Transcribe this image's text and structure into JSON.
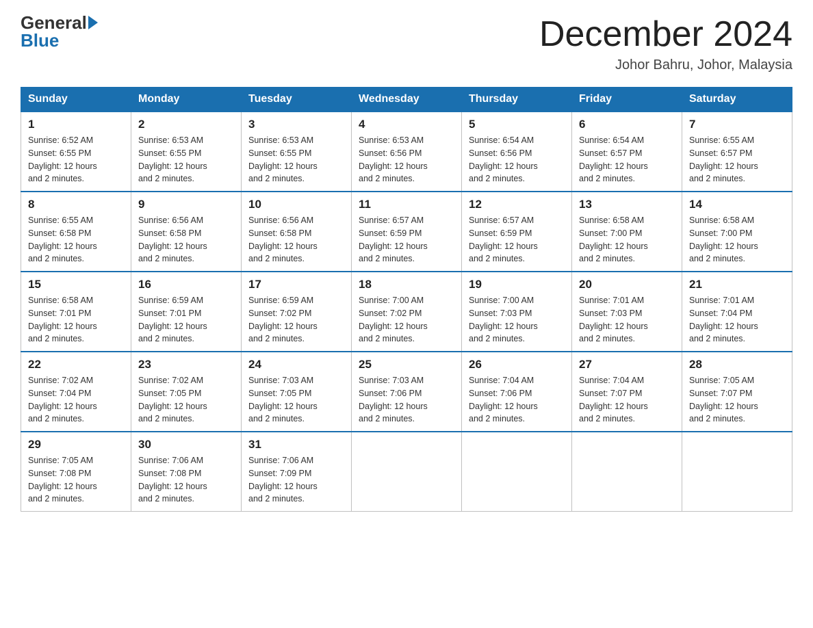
{
  "header": {
    "logo_general": "General",
    "logo_blue": "Blue",
    "title": "December 2024",
    "subtitle": "Johor Bahru, Johor, Malaysia"
  },
  "days_of_week": [
    "Sunday",
    "Monday",
    "Tuesday",
    "Wednesday",
    "Thursday",
    "Friday",
    "Saturday"
  ],
  "weeks": [
    [
      {
        "day": "1",
        "sunrise": "6:52 AM",
        "sunset": "6:55 PM",
        "daylight": "12 hours and 2 minutes."
      },
      {
        "day": "2",
        "sunrise": "6:53 AM",
        "sunset": "6:55 PM",
        "daylight": "12 hours and 2 minutes."
      },
      {
        "day": "3",
        "sunrise": "6:53 AM",
        "sunset": "6:55 PM",
        "daylight": "12 hours and 2 minutes."
      },
      {
        "day": "4",
        "sunrise": "6:53 AM",
        "sunset": "6:56 PM",
        "daylight": "12 hours and 2 minutes."
      },
      {
        "day": "5",
        "sunrise": "6:54 AM",
        "sunset": "6:56 PM",
        "daylight": "12 hours and 2 minutes."
      },
      {
        "day": "6",
        "sunrise": "6:54 AM",
        "sunset": "6:57 PM",
        "daylight": "12 hours and 2 minutes."
      },
      {
        "day": "7",
        "sunrise": "6:55 AM",
        "sunset": "6:57 PM",
        "daylight": "12 hours and 2 minutes."
      }
    ],
    [
      {
        "day": "8",
        "sunrise": "6:55 AM",
        "sunset": "6:58 PM",
        "daylight": "12 hours and 2 minutes."
      },
      {
        "day": "9",
        "sunrise": "6:56 AM",
        "sunset": "6:58 PM",
        "daylight": "12 hours and 2 minutes."
      },
      {
        "day": "10",
        "sunrise": "6:56 AM",
        "sunset": "6:58 PM",
        "daylight": "12 hours and 2 minutes."
      },
      {
        "day": "11",
        "sunrise": "6:57 AM",
        "sunset": "6:59 PM",
        "daylight": "12 hours and 2 minutes."
      },
      {
        "day": "12",
        "sunrise": "6:57 AM",
        "sunset": "6:59 PM",
        "daylight": "12 hours and 2 minutes."
      },
      {
        "day": "13",
        "sunrise": "6:58 AM",
        "sunset": "7:00 PM",
        "daylight": "12 hours and 2 minutes."
      },
      {
        "day": "14",
        "sunrise": "6:58 AM",
        "sunset": "7:00 PM",
        "daylight": "12 hours and 2 minutes."
      }
    ],
    [
      {
        "day": "15",
        "sunrise": "6:58 AM",
        "sunset": "7:01 PM",
        "daylight": "12 hours and 2 minutes."
      },
      {
        "day": "16",
        "sunrise": "6:59 AM",
        "sunset": "7:01 PM",
        "daylight": "12 hours and 2 minutes."
      },
      {
        "day": "17",
        "sunrise": "6:59 AM",
        "sunset": "7:02 PM",
        "daylight": "12 hours and 2 minutes."
      },
      {
        "day": "18",
        "sunrise": "7:00 AM",
        "sunset": "7:02 PM",
        "daylight": "12 hours and 2 minutes."
      },
      {
        "day": "19",
        "sunrise": "7:00 AM",
        "sunset": "7:03 PM",
        "daylight": "12 hours and 2 minutes."
      },
      {
        "day": "20",
        "sunrise": "7:01 AM",
        "sunset": "7:03 PM",
        "daylight": "12 hours and 2 minutes."
      },
      {
        "day": "21",
        "sunrise": "7:01 AM",
        "sunset": "7:04 PM",
        "daylight": "12 hours and 2 minutes."
      }
    ],
    [
      {
        "day": "22",
        "sunrise": "7:02 AM",
        "sunset": "7:04 PM",
        "daylight": "12 hours and 2 minutes."
      },
      {
        "day": "23",
        "sunrise": "7:02 AM",
        "sunset": "7:05 PM",
        "daylight": "12 hours and 2 minutes."
      },
      {
        "day": "24",
        "sunrise": "7:03 AM",
        "sunset": "7:05 PM",
        "daylight": "12 hours and 2 minutes."
      },
      {
        "day": "25",
        "sunrise": "7:03 AM",
        "sunset": "7:06 PM",
        "daylight": "12 hours and 2 minutes."
      },
      {
        "day": "26",
        "sunrise": "7:04 AM",
        "sunset": "7:06 PM",
        "daylight": "12 hours and 2 minutes."
      },
      {
        "day": "27",
        "sunrise": "7:04 AM",
        "sunset": "7:07 PM",
        "daylight": "12 hours and 2 minutes."
      },
      {
        "day": "28",
        "sunrise": "7:05 AM",
        "sunset": "7:07 PM",
        "daylight": "12 hours and 2 minutes."
      }
    ],
    [
      {
        "day": "29",
        "sunrise": "7:05 AM",
        "sunset": "7:08 PM",
        "daylight": "12 hours and 2 minutes."
      },
      {
        "day": "30",
        "sunrise": "7:06 AM",
        "sunset": "7:08 PM",
        "daylight": "12 hours and 2 minutes."
      },
      {
        "day": "31",
        "sunrise": "7:06 AM",
        "sunset": "7:09 PM",
        "daylight": "12 hours and 2 minutes."
      },
      null,
      null,
      null,
      null
    ]
  ],
  "labels": {
    "sunrise": "Sunrise:",
    "sunset": "Sunset:",
    "daylight": "Daylight:"
  }
}
